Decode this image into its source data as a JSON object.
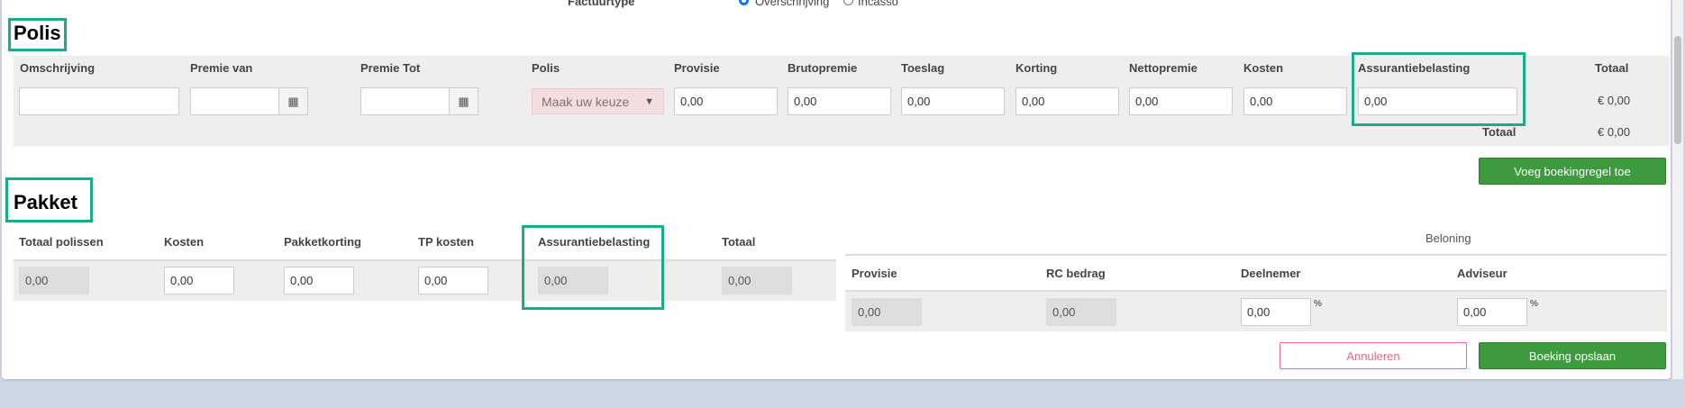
{
  "top": {
    "factuurtype_label": "Factuurtype",
    "radio_option1": "Overschrijving",
    "radio_option2": "Incasso"
  },
  "polis": {
    "title": "Polis",
    "headers": {
      "omschrijving": "Omschrijving",
      "premie_van": "Premie van",
      "premie_tot": "Premie Tot",
      "polis": "Polis",
      "provisie": "Provisie",
      "brutopremie": "Brutopremie",
      "toeslag": "Toeslag",
      "korting": "Korting",
      "nettopremie": "Nettopremie",
      "kosten": "Kosten",
      "assurantiebelasting": "Assurantiebelasting",
      "totaal": "Totaal"
    },
    "select_placeholder": "Maak uw keuze",
    "values": {
      "provisie": "0,00",
      "brutopremie": "0,00",
      "toeslag": "0,00",
      "korting": "0,00",
      "nettopremie": "0,00",
      "kosten": "0,00",
      "assurantiebelasting": "0,00"
    },
    "row_total": "€ 0,00",
    "totaal_label": "Totaal",
    "grand_total": "€ 0,00",
    "add_button": "Voeg boekingregel toe"
  },
  "pakket": {
    "title": "Pakket",
    "headers": {
      "totaal_polissen": "Totaal polissen",
      "kosten": "Kosten",
      "pakketkorting": "Pakketkorting",
      "tp_kosten": "TP kosten",
      "assurantiebelasting": "Assurantiebelasting",
      "totaal": "Totaal"
    },
    "values": {
      "totaal_polissen": "0,00",
      "kosten": "0,00",
      "pakketkorting": "0,00",
      "tp_kosten": "0,00",
      "assurantiebelasting": "0,00",
      "totaal": "0,00"
    }
  },
  "beloning": {
    "title": "Beloning",
    "headers": {
      "provisie": "Provisie",
      "rc_bedrag": "RC bedrag",
      "deelnemer": "Deelnemer",
      "adviseur": "Adviseur"
    },
    "values": {
      "provisie": "0,00",
      "rc_bedrag": "0,00",
      "deelnemer": "0,00",
      "adviseur": "0,00"
    },
    "percent_sign": "%"
  },
  "actions": {
    "cancel": "Annuleren",
    "save": "Boeking opslaan"
  },
  "colors": {
    "highlight": "#1aab8a",
    "green_button": "#3e9a3e",
    "cancel_border": "#e06a8a",
    "select_bg": "#f2dede"
  },
  "icons": {
    "calendar": "calendar-icon",
    "dropdown": "chevron-down-icon"
  }
}
